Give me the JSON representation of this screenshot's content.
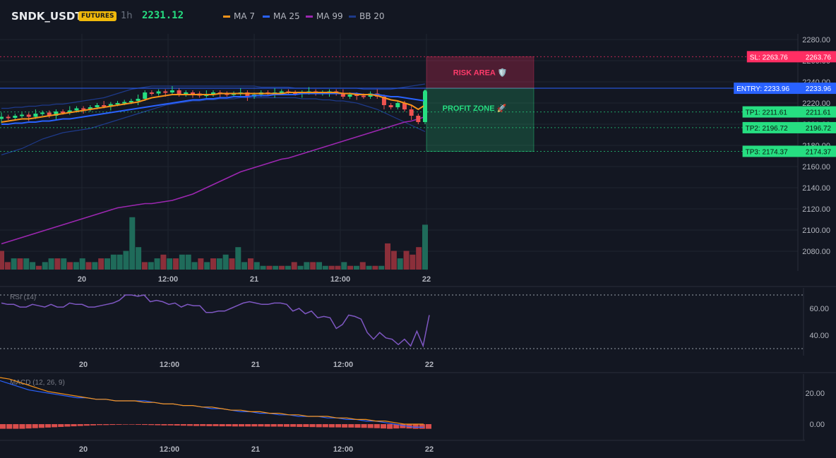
{
  "header": {
    "symbol": "SNDK_USDT",
    "badge": "FUTURES",
    "timeframe": "1h",
    "last_price": "2231.12",
    "legend": [
      {
        "name": "MA 7",
        "color": "#f7931a"
      },
      {
        "name": "MA 25",
        "color": "#2962ff"
      },
      {
        "name": "MA 99",
        "color": "#9c27b0"
      },
      {
        "name": "BB 20",
        "color": "#1e3a8a"
      }
    ]
  },
  "colors": {
    "background": "#131722",
    "grid": "#1f2430",
    "up": "#26de81",
    "down": "#ef5350",
    "risk": "#ff2e63",
    "profit": "#26de81",
    "entry": "#2962ff",
    "rsi": "#7e57c2",
    "macd": "#2962ff",
    "signal": "#f7931a"
  },
  "chart_data": [
    {
      "type": "candlestick",
      "price_axis": {
        "ylim": [
          2064,
          2284
        ],
        "ticks": [
          "2280.00",
          "2260.00",
          "2240.00",
          "2220.00",
          "2200.00",
          "2180.00",
          "2160.00",
          "2140.00",
          "2120.00",
          "2100.00",
          "2080.00"
        ]
      },
      "x_labels": [
        "20",
        "12:00",
        "21",
        "12:00",
        "22"
      ],
      "candles_close": [
        2207,
        2206,
        2208,
        2209,
        2207,
        2210,
        2211,
        2208,
        2212,
        2211,
        2213,
        2215,
        2214,
        2216,
        2218,
        2217,
        2219,
        2220,
        2221,
        2222,
        2224,
        2230,
        2229,
        2231,
        2230,
        2232,
        2228,
        2230,
        2229,
        2227,
        2228,
        2230,
        2229,
        2228,
        2229,
        2230,
        2226,
        2228,
        2230,
        2229,
        2230,
        2231,
        2230,
        2229,
        2230,
        2231,
        2229,
        2230,
        2231,
        2229,
        2226,
        2228,
        2227,
        2226,
        2229,
        2226,
        2218,
        2216,
        2220,
        2214,
        2208,
        2202,
        2231
      ],
      "candles_open": [
        2205,
        2207,
        2206,
        2208,
        2209,
        2207,
        2210,
        2211,
        2208,
        2212,
        2211,
        2213,
        2215,
        2214,
        2216,
        2218,
        2217,
        2219,
        2220,
        2221,
        2222,
        2224,
        2230,
        2229,
        2231,
        2230,
        2232,
        2228,
        2230,
        2229,
        2227,
        2228,
        2230,
        2229,
        2228,
        2229,
        2230,
        2226,
        2228,
        2230,
        2229,
        2230,
        2231,
        2230,
        2229,
        2230,
        2231,
        2229,
        2230,
        2231,
        2229,
        2226,
        2228,
        2227,
        2226,
        2229,
        2226,
        2218,
        2216,
        2220,
        2214,
        2208,
        2202
      ],
      "series": [
        {
          "name": "MA 7",
          "values": [
            2202,
            2203,
            2204,
            2205,
            2205,
            2206,
            2207,
            2208,
            2209,
            2210,
            2211,
            2212,
            2213,
            2214,
            2215,
            2216,
            2217,
            2218,
            2219,
            2220,
            2221,
            2223,
            2225,
            2226,
            2227,
            2228,
            2228,
            2228,
            2228,
            2228,
            2228,
            2228,
            2229,
            2229,
            2229,
            2229,
            2229,
            2229,
            2229,
            2229,
            2229,
            2229,
            2230,
            2230,
            2230,
            2230,
            2230,
            2230,
            2230,
            2230,
            2229,
            2229,
            2228,
            2228,
            2228,
            2227,
            2225,
            2223,
            2222,
            2220,
            2218,
            2214,
            2218
          ]
        },
        {
          "name": "MA 25",
          "values": [
            2200,
            2200,
            2201,
            2201,
            2202,
            2202,
            2203,
            2203,
            2204,
            2205,
            2205,
            2206,
            2207,
            2208,
            2209,
            2210,
            2211,
            2212,
            2213,
            2214,
            2215,
            2216,
            2217,
            2218,
            2219,
            2220,
            2221,
            2222,
            2223,
            2223,
            2224,
            2224,
            2225,
            2225,
            2226,
            2226,
            2226,
            2227,
            2227,
            2227,
            2228,
            2228,
            2228,
            2228,
            2229,
            2229,
            2229,
            2229,
            2229,
            2229,
            2229,
            2229,
            2229,
            2228,
            2228,
            2228,
            2227,
            2226,
            2226,
            2225,
            2224,
            2223,
            2222
          ]
        },
        {
          "name": "MA 99",
          "values": [
            2087,
            2089,
            2091,
            2093,
            2095,
            2097,
            2099,
            2101,
            2103,
            2105,
            2107,
            2109,
            2111,
            2113,
            2115,
            2117,
            2119,
            2121,
            2122,
            2123,
            2124,
            2125,
            2125,
            2126,
            2127,
            2128,
            2130,
            2132,
            2134,
            2137,
            2140,
            2143,
            2146,
            2149,
            2152,
            2155,
            2157,
            2159,
            2161,
            2163,
            2165,
            2167,
            2168,
            2170,
            2172,
            2174,
            2176,
            2178,
            2180,
            2182,
            2184,
            2186,
            2188,
            2190,
            2192,
            2194,
            2196,
            2198,
            2200,
            2202,
            2203,
            2205,
            2207
          ]
        },
        {
          "name": "BB 20 upper",
          "values": [
            2215,
            2215,
            2216,
            2216,
            2217,
            2217,
            2218,
            2218,
            2219,
            2219,
            2220,
            2221,
            2222,
            2223,
            2224,
            2225,
            2227,
            2229,
            2231,
            2233,
            2234,
            2235,
            2236,
            2236,
            2236,
            2236,
            2236,
            2236,
            2236,
            2236,
            2236,
            2236,
            2236,
            2236,
            2236,
            2236,
            2236,
            2236,
            2235,
            2235,
            2235,
            2235,
            2235,
            2234,
            2234,
            2234,
            2234,
            2234,
            2234,
            2234,
            2234,
            2234,
            2234,
            2233,
            2233,
            2233,
            2233,
            2233,
            2234,
            2235,
            2236,
            2237,
            2238
          ]
        },
        {
          "name": "BB 20 lower",
          "values": [
            2171,
            2173,
            2175,
            2177,
            2180,
            2183,
            2186,
            2188,
            2190,
            2192,
            2193,
            2194,
            2195,
            2196,
            2198,
            2200,
            2202,
            2204,
            2206,
            2208,
            2210,
            2212,
            2214,
            2216,
            2218,
            2219,
            2220,
            2221,
            2222,
            2222,
            2223,
            2223,
            2224,
            2224,
            2224,
            2225,
            2225,
            2225,
            2225,
            2225,
            2225,
            2225,
            2225,
            2225,
            2224,
            2224,
            2224,
            2223,
            2223,
            2222,
            2222,
            2221,
            2220,
            2218,
            2216,
            2214,
            2211,
            2208,
            2205,
            2202,
            2199,
            2196,
            2193
          ]
        }
      ],
      "volume": [
        5,
        2,
        3,
        3,
        3,
        2,
        1,
        2,
        3,
        3,
        3,
        2,
        2,
        3,
        2,
        2,
        3,
        3,
        4,
        4,
        5,
        14,
        6,
        2,
        2,
        3,
        4,
        3,
        3,
        4,
        4,
        2,
        3,
        2,
        3,
        3,
        4,
        3,
        6,
        2,
        3,
        2,
        1,
        1,
        1,
        1,
        1,
        2,
        1,
        2,
        2,
        2,
        1,
        1,
        1,
        2,
        1,
        1,
        2,
        1,
        1,
        1,
        7,
        5,
        3,
        5,
        4,
        6,
        12
      ],
      "volume_up": [
        false,
        false,
        true,
        false,
        true,
        true,
        false,
        true,
        true,
        false,
        true,
        false,
        true,
        true,
        false,
        true,
        false,
        true,
        true,
        true,
        true,
        true,
        true,
        false,
        true,
        true,
        false,
        true,
        false,
        true,
        true,
        true,
        false,
        true,
        false,
        true,
        true,
        false,
        true,
        true,
        false,
        true,
        true,
        false,
        true,
        false,
        true,
        false,
        true,
        true,
        false,
        true,
        true,
        false,
        false,
        true,
        false,
        true,
        false,
        true,
        false,
        true,
        false,
        false,
        true,
        false,
        false,
        false,
        true
      ],
      "trade_levels": [
        {
          "label": "SL: 2263.76",
          "value": "2263.76",
          "price": 2263.76,
          "color": "#ff2e63"
        },
        {
          "label": "ENTRY: 2233.96",
          "value": "2233.96",
          "price": 2233.96,
          "color": "#2962ff"
        },
        {
          "label": "TP1: 2211.61",
          "value": "2211.61",
          "price": 2211.61,
          "color": "#26de81"
        },
        {
          "label": "TP2: 2196.72",
          "value": "2196.72",
          "price": 2196.72,
          "color": "#26de81"
        },
        {
          "label": "TP3: 2174.37",
          "value": "2174.37",
          "price": 2174.37,
          "color": "#26de81"
        }
      ],
      "zones": {
        "risk_label": "RISK AREA 🛡️",
        "profit_label": "PROFIT ZONE 🚀"
      }
    },
    {
      "type": "line",
      "title": "RSI (14)",
      "ylim": [
        28,
        72
      ],
      "ticks": [
        "60.00",
        "40.00"
      ],
      "overbought": 70,
      "oversold": 30,
      "values": [
        64,
        63,
        63,
        61,
        61,
        63,
        62,
        61,
        63,
        61,
        61,
        64,
        63,
        63,
        61,
        61,
        62,
        63,
        64,
        66,
        70,
        70,
        69,
        70,
        65,
        66,
        65,
        63,
        64,
        61,
        63,
        62,
        62,
        57,
        57,
        58,
        58,
        60,
        62,
        64,
        65,
        64,
        63,
        63,
        64,
        64,
        63,
        58,
        60,
        56,
        58,
        53,
        54,
        53,
        45,
        48,
        55,
        54,
        52,
        42,
        37,
        42,
        38,
        37,
        33,
        37,
        32,
        43,
        32,
        55
      ]
    },
    {
      "type": "line",
      "title": "MACD (12, 26, 9)",
      "ylim": [
        -6,
        32
      ],
      "ticks": [
        "20.00",
        "0.00"
      ],
      "macd": [
        28,
        26,
        24,
        22,
        21,
        20,
        19,
        18,
        17,
        17,
        16,
        16,
        15,
        15,
        15,
        15,
        14,
        13,
        13,
        12,
        12,
        11,
        10,
        10,
        9,
        8,
        8,
        7,
        7,
        6,
        6,
        5,
        5,
        5,
        4,
        4,
        3,
        3,
        2,
        2,
        1,
        0,
        -1,
        -2,
        -2
      ],
      "signal": [
        30,
        29,
        27,
        25,
        23,
        21,
        20,
        19,
        18,
        17,
        16,
        16,
        15,
        15,
        15,
        14,
        14,
        13,
        13,
        12,
        12,
        11,
        11,
        10,
        9,
        9,
        8,
        8,
        7,
        7,
        6,
        6,
        5,
        5,
        5,
        4,
        4,
        3,
        3,
        2,
        2,
        1,
        0,
        0,
        0
      ],
      "histogram": [
        -3,
        -3,
        -3,
        -3,
        -2.8,
        -2.6,
        -2.4,
        -2.2,
        -2,
        -1.8,
        -1.6,
        -1.4,
        -1.2,
        -1,
        -0.8,
        -0.6,
        -0.6,
        -0.5,
        -0.4,
        -0.3,
        -0.3,
        -0.4,
        -0.5,
        -0.6,
        -0.7,
        -0.8,
        -0.8,
        -0.9,
        -1,
        -1.1,
        -1.2,
        -1.2,
        -1.3,
        -1.3,
        -1.4,
        -1.4,
        -1.5,
        -1.5,
        -1.5,
        -1.5,
        -1.5,
        -1.6,
        -1.6,
        -1.6,
        -1.7,
        -1.7,
        -1.8,
        -1.8,
        -1.9,
        -2,
        -2,
        -2.1,
        -2.1,
        -2.2,
        -2.2,
        -2.3,
        -2.4,
        -2.5,
        -2.6,
        -2.8,
        -3,
        -2.8,
        -2.6,
        -2.8,
        -3,
        -3,
        -3
      ]
    }
  ]
}
